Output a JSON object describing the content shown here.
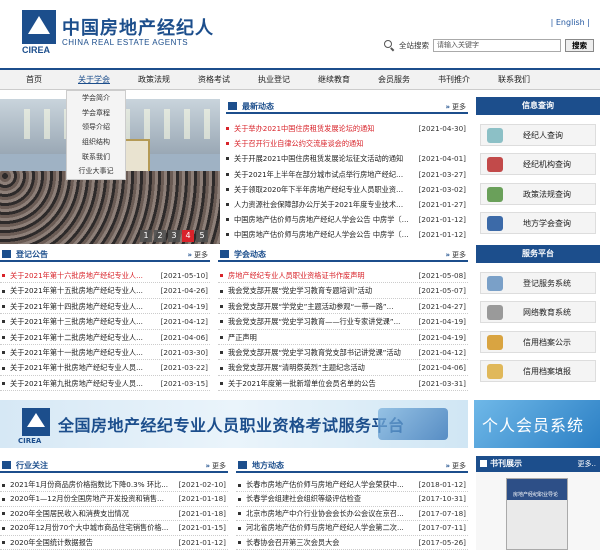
{
  "header": {
    "logo_abbr": "CIREA",
    "logo_cn": "中国房地产经纪人",
    "logo_en": "CHINA REAL ESTATE AGENTS",
    "english_link": "| English |",
    "search_label": "全站搜索",
    "search_placeholder": "请输入关键字",
    "search_button": "搜索"
  },
  "nav": [
    {
      "label": "首页"
    },
    {
      "label": "关于学会",
      "active": true
    },
    {
      "label": "政策法规"
    },
    {
      "label": "资格考试"
    },
    {
      "label": "执业登记"
    },
    {
      "label": "继续教育"
    },
    {
      "label": "会员服务"
    },
    {
      "label": "书刊推介"
    },
    {
      "label": "联系我们"
    }
  ],
  "submenu": [
    "学会简介",
    "学会章程",
    "领导介绍",
    "组织结构",
    "联系我们",
    "行业大事记"
  ],
  "slideshow": {
    "pages": [
      "1",
      "2",
      "3",
      "4",
      "5"
    ],
    "active_page": "4"
  },
  "latest_news": {
    "title": "最新动态",
    "more": "更多",
    "items": [
      {
        "text": "关于举办2021中国住房租赁发展论坛的通知",
        "date": "[2021-04-30]",
        "red": true
      },
      {
        "text": "关于召开行业自律公约交流座谈会的通知",
        "date": "",
        "red": true
      },
      {
        "text": "关于开展2021中国住房租赁发展论坛征文活动的通知",
        "date": "[2021-04-01]",
        "red": false
      },
      {
        "text": "关于2021年上半年在部分城市试点举行房地产经纪专业人员...",
        "date": "[2021-03-27]",
        "red": false
      },
      {
        "text": "关于领取2020年下半年房地产经纪专业人员职业资格证...",
        "date": "[2021-03-02]",
        "red": false
      },
      {
        "text": "人力资源社会保障部办公厅关于2021年度专业技术人员...",
        "date": "[2021-01-27]",
        "red": false
      },
      {
        "text": "中国房地产估价师与房地产经纪人学会公告 中房学〔2021...",
        "date": "[2021-01-12]",
        "red": false
      },
      {
        "text": "中国房地产估价师与房地产经纪人学会公告 中房学〔2021...",
        "date": "[2021-01-12]",
        "red": false
      }
    ]
  },
  "registration": {
    "title": "登记公告",
    "more": "更多",
    "items": [
      {
        "text": "关于2021年第十六批房地产经纪专业人...",
        "date": "[2021-05-10]",
        "red": true
      },
      {
        "text": "关于2021年第十五批房地产经纪专业人...",
        "date": "[2021-04-26]",
        "red": false
      },
      {
        "text": "关于2021年第十四批房地产经纪专业人...",
        "date": "[2021-04-19]",
        "red": false
      },
      {
        "text": "关于2021年第十三批房地产经纪专业人...",
        "date": "[2021-04-12]",
        "red": false
      },
      {
        "text": "关于2021年第十二批房地产经纪专业人...",
        "date": "[2021-04-06]",
        "red": false
      },
      {
        "text": "关于2021年第十一批房地产经纪专业人...",
        "date": "[2021-03-30]",
        "red": false
      },
      {
        "text": "关于2021年第十批房地产经纪专业人员...",
        "date": "[2021-03-22]",
        "red": false
      },
      {
        "text": "关于2021年第九批房地产经纪专业人员...",
        "date": "[2021-03-15]",
        "red": false
      }
    ]
  },
  "association": {
    "title": "学会动态",
    "more": "更多",
    "items": [
      {
        "text": "房地产经纪专业人员职业资格证书作废声明",
        "date": "[2021-05-08]",
        "red": true
      },
      {
        "text": "我会党支部开展“党史学习教育专题培训”活动",
        "date": "[2021-05-07]",
        "red": false
      },
      {
        "text": "我会党支部开展“学党史”主题活动参观“一带一路”...",
        "date": "[2021-04-27]",
        "red": false
      },
      {
        "text": "我会党支部开展“党史学习教育——行业专家讲党课”...",
        "date": "[2021-04-19]",
        "red": false
      },
      {
        "text": "严正声明",
        "date": "[2021-04-19]",
        "red": false
      },
      {
        "text": "我会党支部开展“党史学习教育党支部书记讲党课”活动",
        "date": "[2021-04-12]",
        "red": false
      },
      {
        "text": "我会党支部开展“清明祭英烈”主题纪念活动",
        "date": "[2021-04-06]",
        "red": false
      },
      {
        "text": "关于2021年度第一批新增单位会员名单的公告",
        "date": "[2021-03-31]",
        "red": false
      }
    ]
  },
  "info_query": {
    "title": "信息查询",
    "buttons": [
      "经纪人查询",
      "经纪机构查询",
      "政策法规查询",
      "地方学会查询"
    ]
  },
  "service_platform": {
    "title": "服务平台",
    "buttons": [
      "登记服务系统",
      "网络教育系统",
      "信用档案公示",
      "信用档案填报"
    ]
  },
  "banner": {
    "abbr": "CIREA",
    "text": "全国房地产经纪专业人员职业资格考试服务平台",
    "member_text": "个人会员系统"
  },
  "industry": {
    "title": "行业关注",
    "more": "更多",
    "items": [
      {
        "text": "2021年1月份商品房价格指数比下降0.3% 环比...",
        "date": "[2021-02-10]"
      },
      {
        "text": "2020年1—12月份全国房地产开发投资和销售...",
        "date": "[2021-01-18]"
      },
      {
        "text": "2020年全国居民收入和消费支出情况",
        "date": "[2021-01-18]"
      },
      {
        "text": "2020年12月份70个大中城市商品住宅销售价格...",
        "date": "[2021-01-15]"
      },
      {
        "text": "2020年全国统计数据报告",
        "date": "[2021-01-12]"
      }
    ]
  },
  "local": {
    "title": "地方动态",
    "more": "更多",
    "items": [
      {
        "text": "长春市房地产估价师与房地产经纪人学会荣获中...",
        "date": "[2018-01-12]"
      },
      {
        "text": "长春学会组建社会组织等级评估检查",
        "date": "[2017-10-31]"
      },
      {
        "text": "北京市房地产中介行业协会会长办公会议在京召...",
        "date": "[2017-07-18]"
      },
      {
        "text": "河北省房地产估价师与房地产经纪人学会第二次...",
        "date": "[2017-07-11]"
      },
      {
        "text": "长春协会召开第三次会员大会",
        "date": "[2017-05-26]"
      }
    ]
  },
  "books": {
    "title": "书刊展示",
    "more": "更多..",
    "cover_title": "房地产经纪职业导论"
  },
  "colors": {
    "brand": "#1c4e8c",
    "alert": "#d8232a",
    "panel_bg": "#f4f4f4"
  }
}
